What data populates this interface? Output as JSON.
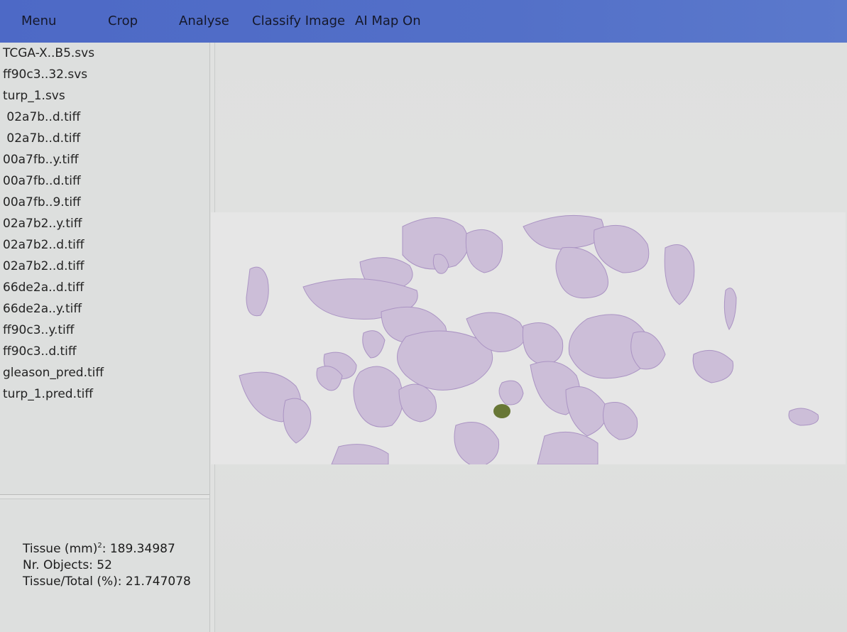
{
  "toolbar": {
    "menu": "Menu",
    "crop": "Crop",
    "analyse": "Analyse",
    "classify": "Classify Image",
    "ai_map": "AI Map On"
  },
  "files": [
    "TCGA-X..B5.svs",
    "ff90c3..32.svs",
    "turp_1.svs",
    " 02a7b..d.tiff",
    " 02a7b..d.tiff",
    "00a7fb..y.tiff",
    "00a7fb..d.tiff",
    "00a7fb..9.tiff",
    "02a7b2..y.tiff",
    "02a7b2..d.tiff",
    "02a7b2..d.tiff",
    "66de2a..d.tiff",
    "66de2a..y.tiff",
    "ff90c3..y.tiff",
    "ff90c3..d.tiff",
    "gleason_pred.tiff",
    "turp_1.pred.tiff"
  ],
  "stats": {
    "tissue_label": "Tissue (mm)",
    "tissue_sup": "2",
    "tissue_value": ": 189.34987",
    "objects": "Nr. Objects: 52",
    "ratio": "Tissue/Total (%): 21.747078"
  },
  "colors": {
    "toolbar": "#5370c8",
    "tissue": "#c9b9d6",
    "tissue_edge": "#a58fc0",
    "highlight": "#5a6a22"
  }
}
